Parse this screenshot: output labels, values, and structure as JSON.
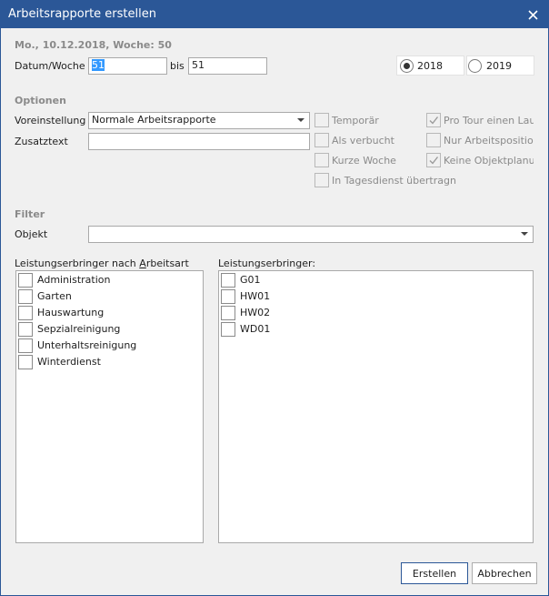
{
  "window": {
    "title": "Arbeitsrapporte erstellen",
    "close_icon": "close-icon"
  },
  "header": {
    "date_line": "Mo., 10.12.2018, Woche: 50"
  },
  "date_range": {
    "label": "Datum/Woche",
    "from_value": "51",
    "to_label": "bis",
    "to_value": "51"
  },
  "years": [
    {
      "label": "2018",
      "selected": true
    },
    {
      "label": "2019",
      "selected": false
    }
  ],
  "options": {
    "section_title": "Optionen",
    "preset_label": "Voreinstellung",
    "preset_value": "Normale Arbeitsrapporte",
    "extra_text_label": "Zusatztext",
    "extra_text_value": "",
    "checkboxes_col1": [
      {
        "label": "Temporär",
        "checked": false
      },
      {
        "label": "Als verbucht",
        "checked": false
      },
      {
        "label": "Kurze Woche",
        "checked": false
      },
      {
        "label": "In Tagesdienst übertragn",
        "checked": false
      }
    ],
    "checkboxes_col2": [
      {
        "label": "Pro Tour einen Lauf",
        "checked": true
      },
      {
        "label": "Nur Arbeitspositionen",
        "checked": false
      },
      {
        "label": "Keine Objektplanung",
        "checked": true
      }
    ]
  },
  "filter": {
    "section_title": "Filter",
    "object_label": "Objekt",
    "object_value": ""
  },
  "by_work_type": {
    "label_pre": "Leistungserbringer nach ",
    "label_accel": "A",
    "label_post": "rbeitsart",
    "items": [
      "Administration",
      "Garten",
      "Hauswartung",
      "Sepzialreinigung",
      "Unterhaltsreinigung",
      "Winterdienst"
    ]
  },
  "providers": {
    "label": "Leistungserbringer:",
    "items": [
      "G01",
      "HW01",
      "HW02",
      "WD01"
    ]
  },
  "buttons": {
    "create": "Erstellen",
    "cancel": "Abbrechen"
  }
}
